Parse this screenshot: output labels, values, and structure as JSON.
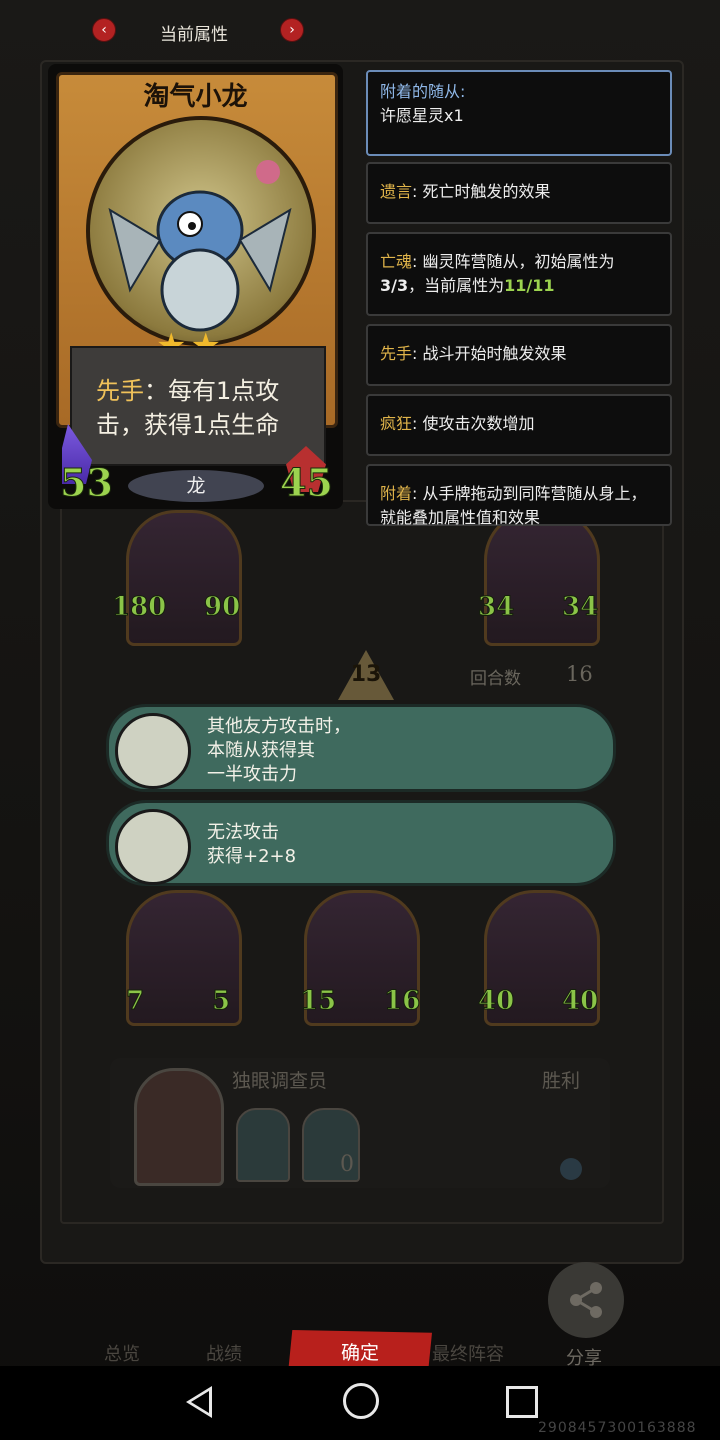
{
  "nav": {
    "title": "当前属性",
    "prev_icon": "chevron-left-icon",
    "next_icon": "chevron-right-icon"
  },
  "card": {
    "name": "淘气小龙",
    "stars": "★★",
    "ability_keyword": "先手",
    "ability_text": "：每有1点攻击，获得1点生命",
    "attack": "53",
    "health": "45",
    "tribe": "龙"
  },
  "tooltips": [
    {
      "key": "附着的随从:",
      "text": "许愿星灵x1"
    },
    {
      "key": "遗言",
      "text": ": 死亡时触发的效果"
    },
    {
      "key": "亡魂",
      "text_pre": ": 幽灵阵营随从，初始属性为",
      "text_bold": "3/3",
      "text_mid": "，当前属性为",
      "text_green": "11/11"
    },
    {
      "key": "先手",
      "text": ": 战斗开始时触发效果"
    },
    {
      "key": "疯狂",
      "text": ": 使攻击次数增加"
    },
    {
      "key": "附着",
      "text": ": 从手牌拖动到同阵营随从身上，就能叠加属性值和效果"
    }
  ],
  "board_minions_top": [
    {
      "atk": "180",
      "hp": "90"
    },
    {
      "atk": "34",
      "hp": "34"
    }
  ],
  "attack_counter": "13",
  "round": {
    "label": "回合数",
    "value": "16"
  },
  "buffs": [
    {
      "lines": [
        "其他友方攻击时，",
        "本随从获得其",
        "一半攻击力"
      ]
    },
    {
      "lines": [
        "无法攻击",
        "获得+2+8"
      ]
    }
  ],
  "board_minions_bottom": [
    {
      "atk": "7",
      "hp": "5"
    },
    {
      "atk": "15",
      "hp": "16"
    },
    {
      "atk": "40",
      "hp": "40"
    }
  ],
  "opponent": {
    "name": "独眼调查员",
    "result": "胜利",
    "hand_count": "0"
  },
  "bottom_tabs": {
    "overview": "总览",
    "record": "战绩",
    "confirm": "确定",
    "lineup": "最终阵容",
    "share": "分享"
  },
  "watermark": "2908457300163888"
}
